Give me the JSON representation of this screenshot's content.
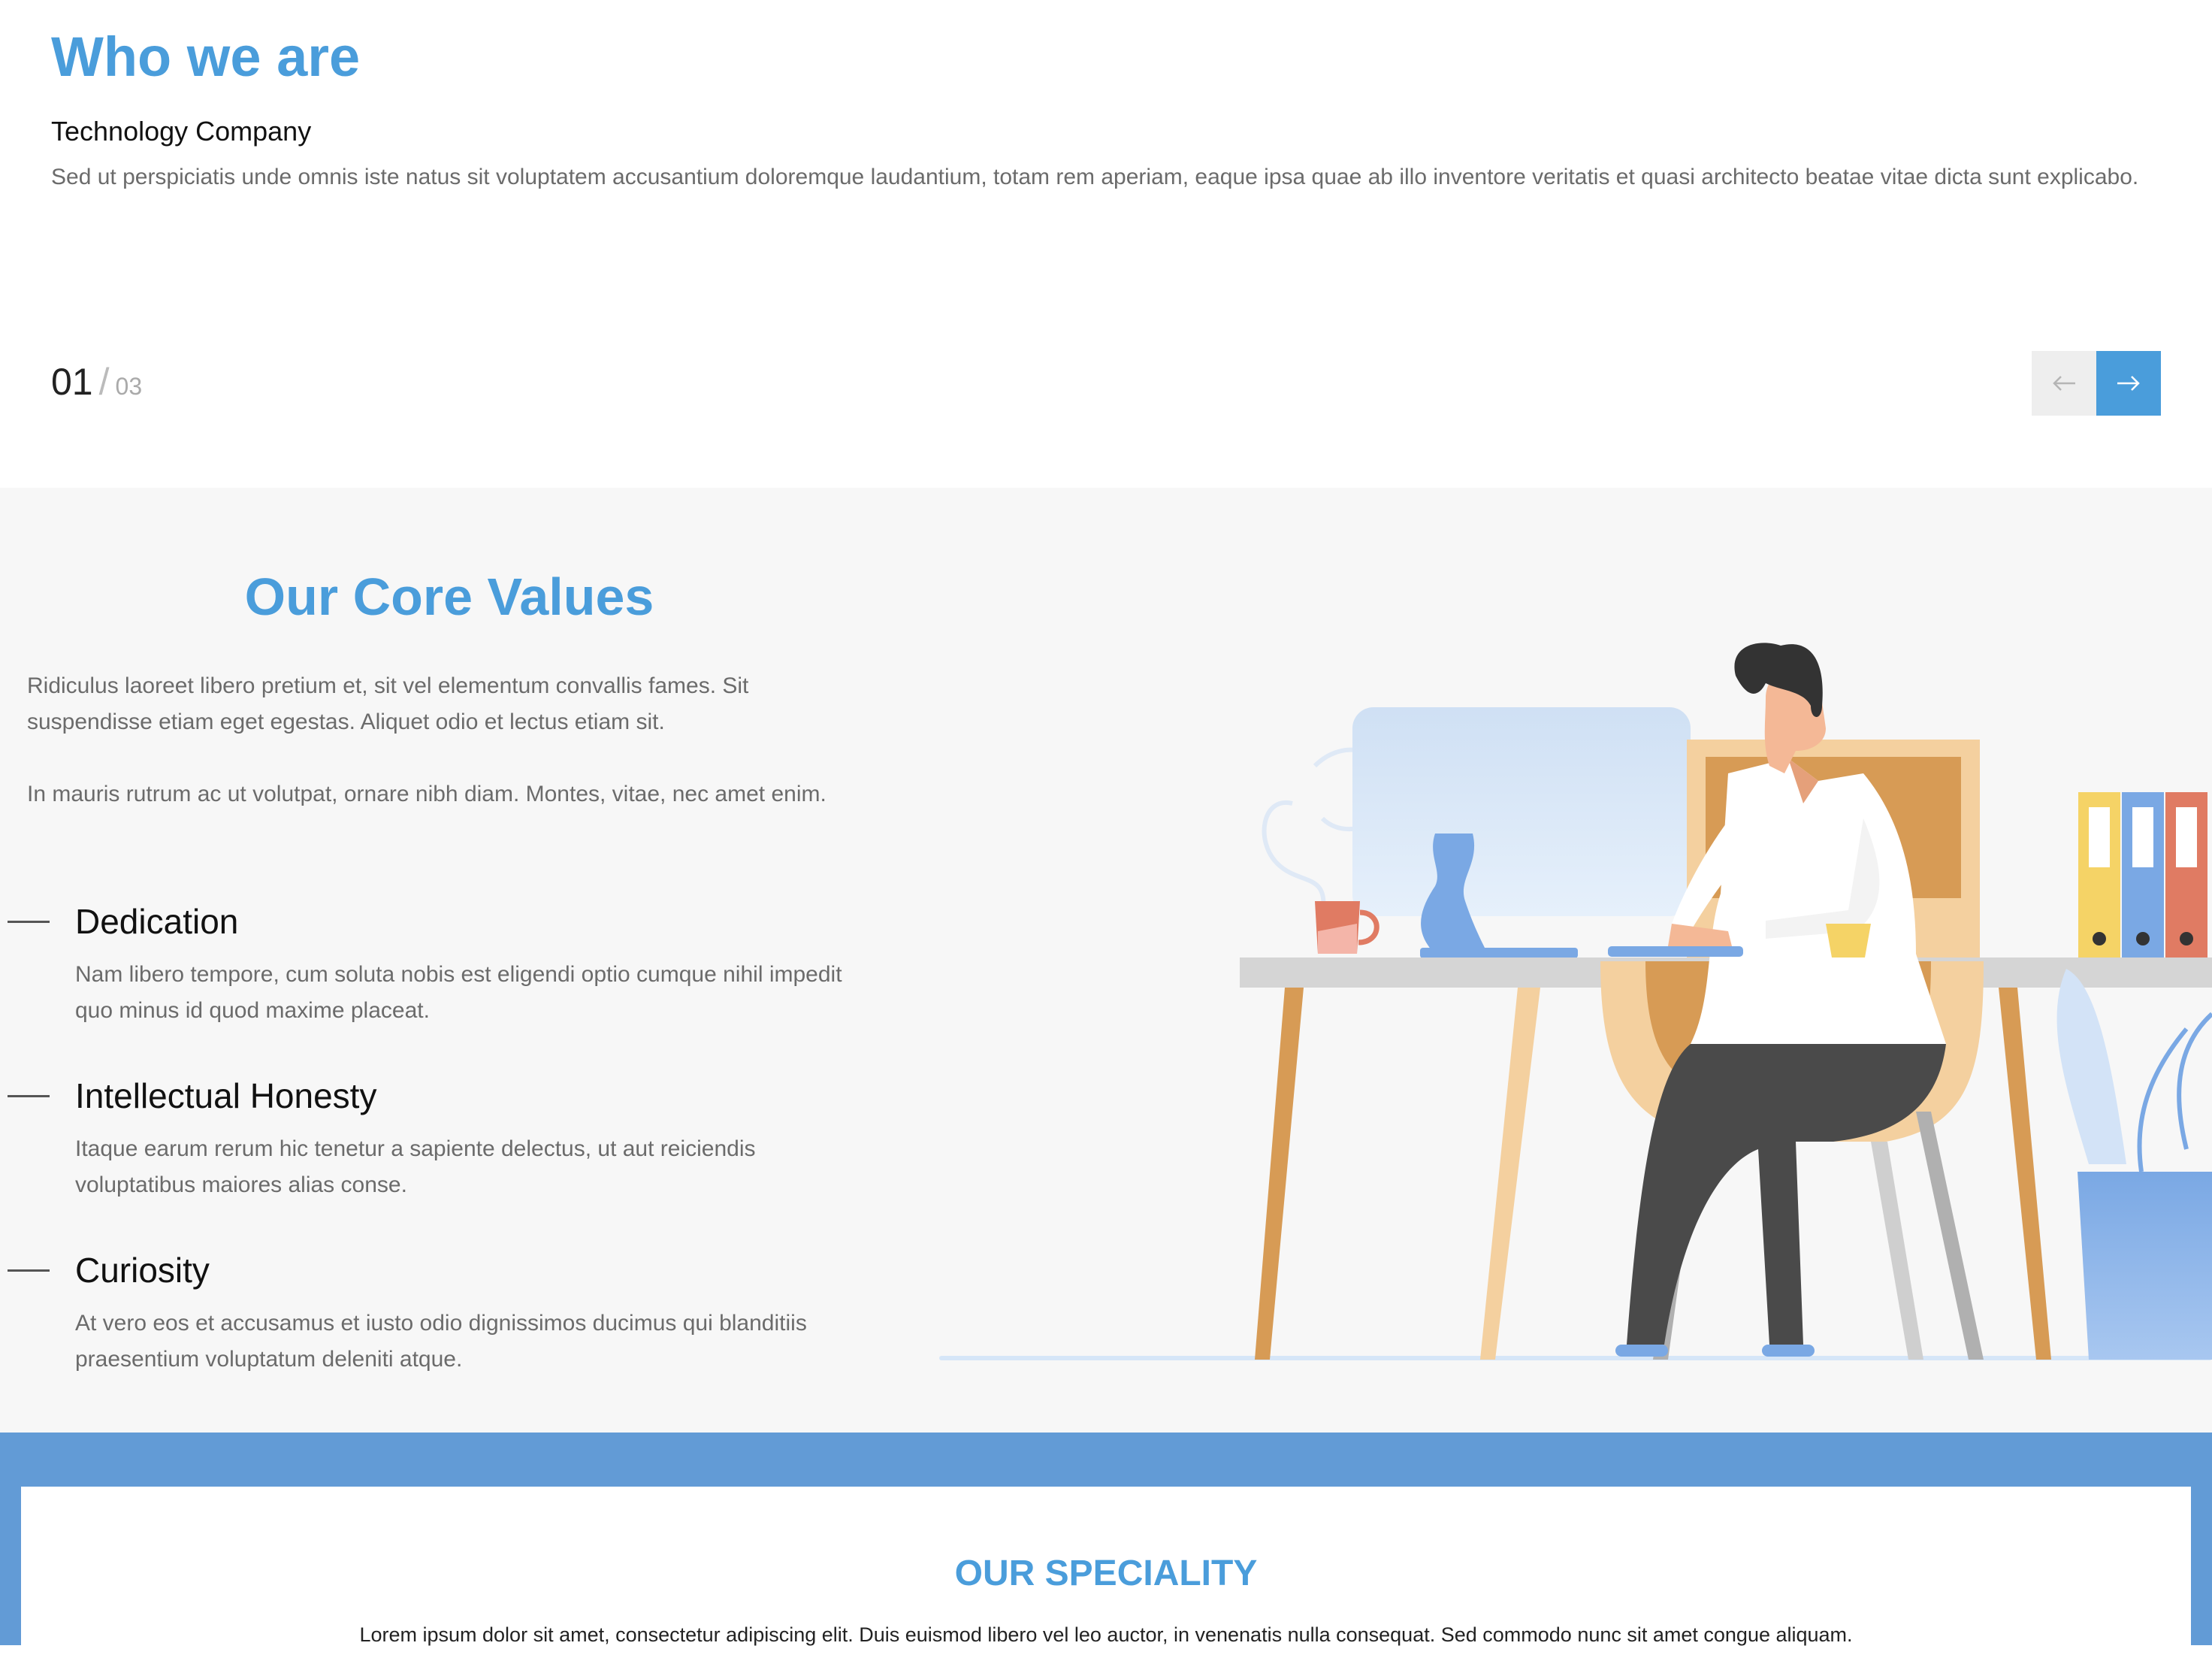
{
  "who": {
    "title": "Who we are",
    "subtitle": "Technology Company",
    "text": "Sed ut perspiciatis unde omnis iste natus sit voluptatem accusantium doloremque laudantium, totam rem aperiam, eaque ipsa quae ab illo inventore veritatis et quasi architecto beatae vitae dicta sunt explicabo.",
    "slider": {
      "current": "01",
      "separator": "/",
      "total": "03",
      "prev_icon": "arrow-left-icon",
      "next_icon": "arrow-right-icon"
    }
  },
  "core": {
    "title": "Our Core Values",
    "paragraph1": "Ridiculus laoreet libero pretium et, sit vel elementum convallis fames. Sit suspendisse etiam eget egestas. Aliquet odio et lectus etiam sit.",
    "paragraph2": "In mauris rutrum ac ut volutpat, ornare nibh diam. Montes, vitae, nec amet enim.",
    "values": [
      {
        "title": "Dedication",
        "text": "Nam libero tempore, cum soluta nobis est eligendi optio cumque nihil impedit quo minus id quod maxime placeat."
      },
      {
        "title": "Intellectual Honesty",
        "text": "Itaque earum rerum hic tenetur a sapiente delectus, ut aut reiciendis voluptatibus maiores alias conse."
      },
      {
        "title": "Curiosity",
        "text": "At vero eos et accusamus et iusto odio dignissimos ducimus qui blanditiis praesentium voluptatum deleniti atque."
      }
    ]
  },
  "speciality": {
    "title": "OUR SPECIALITY",
    "text": "Lorem ipsum dolor sit amet, consectetur adipiscing elit. Duis euismod libero vel leo auctor, in venenatis nulla consequat. Sed commodo nunc sit amet congue aliquam."
  },
  "colors": {
    "accent": "#4a9ddb",
    "band": "#629bd6",
    "section_bg": "#f7f7f7",
    "body_text": "#6b6b6b"
  }
}
